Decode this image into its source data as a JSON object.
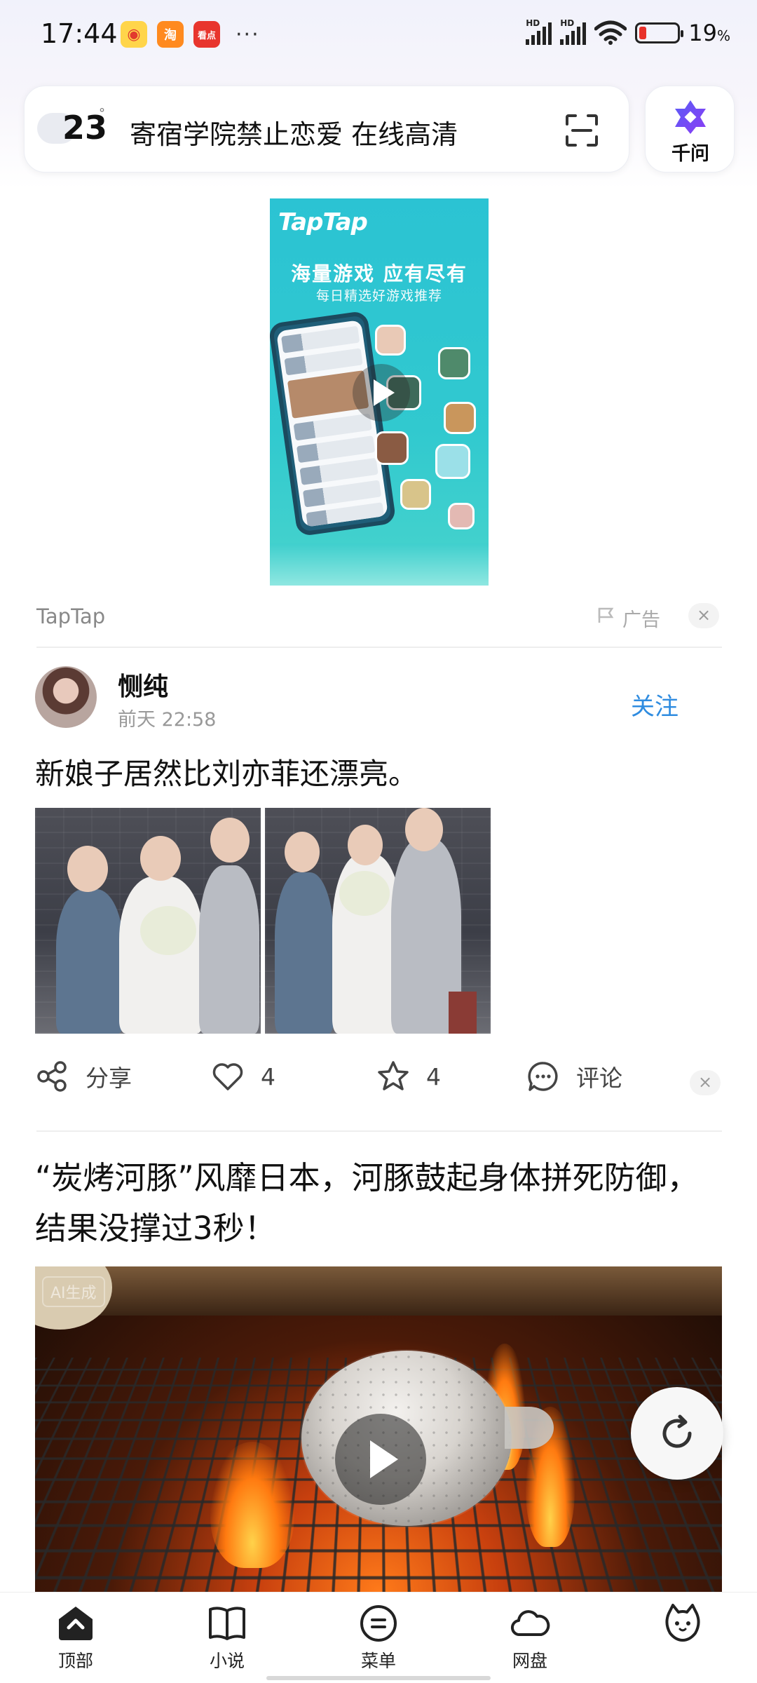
{
  "status_bar": {
    "time": "17:44",
    "notification_icons": [
      "weibo-icon",
      "taobao-icon",
      "kandian-icon"
    ],
    "more": "···",
    "hd1": "HD",
    "hd2": "HD",
    "battery_percent": "19",
    "battery_unit": "%",
    "battery_level": 0.19,
    "battery_color": "#e8312a"
  },
  "search_bar": {
    "weather_temp": "23",
    "weather_unit": "°",
    "query": "寄宿学院禁止恋爱 在线高清",
    "scan_icon": "scan-icon"
  },
  "qianwen": {
    "label": "千问",
    "icon": "qianwen-logo-icon"
  },
  "ad": {
    "logo": "TapTap",
    "slogan": "海量游戏 应有尽有",
    "subtitle": "每日精选好游戏推荐",
    "source": "TapTap",
    "label": "广告",
    "close": "×"
  },
  "post": {
    "username": "恻纯",
    "time": "前天 22:58",
    "follow": "关注",
    "text": "新娘子居然比刘亦菲还漂亮。",
    "actions": {
      "share": "分享",
      "like_count": "4",
      "favorite_count": "4",
      "comment": "评论",
      "close": "×"
    }
  },
  "article": {
    "title": "“炭烤河豚”风靡日本，河豚鼓起身体拼死防御，结果没撑过3秒！",
    "ai_badge": "AI生成"
  },
  "bottom_nav": {
    "items": [
      {
        "label": "顶部",
        "icon": "up-arrow-icon"
      },
      {
        "label": "小说",
        "icon": "book-icon"
      },
      {
        "label": "菜单",
        "icon": "menu-icon"
      },
      {
        "label": "网盘",
        "icon": "cloud-icon"
      },
      {
        "label": "",
        "icon": "cat-avatar-icon"
      }
    ]
  },
  "colors": {
    "accent": "#2f8ce0",
    "ad_background": "#2bc3d3"
  }
}
